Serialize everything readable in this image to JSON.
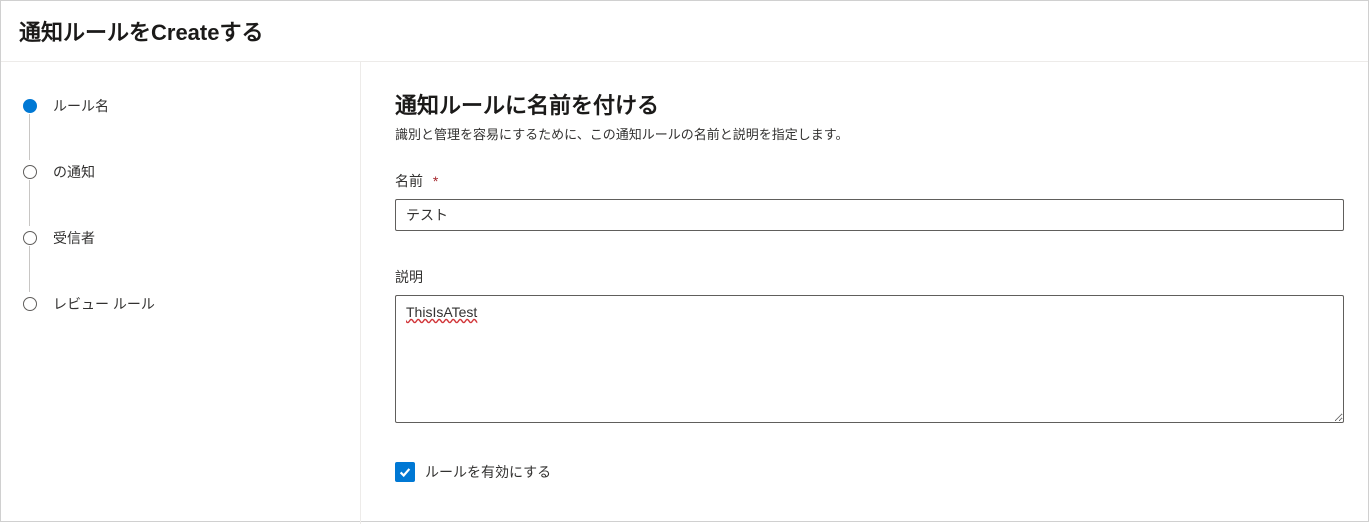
{
  "header": {
    "title": "通知ルールをCreateする"
  },
  "sidebar": {
    "steps": [
      {
        "label": "ルール名",
        "active": true
      },
      {
        "label": "の通知",
        "active": false
      },
      {
        "label": "受信者",
        "active": false
      },
      {
        "label": "レビュー ルール",
        "active": false
      }
    ]
  },
  "main": {
    "section_title": "通知ルールに名前を付ける",
    "section_desc": "識別と管理を容易にするために、この通知ルールの名前と説明を指定します。",
    "name_label": "名前",
    "name_value": "テスト",
    "desc_label": "説明",
    "desc_value": "ThisIsATest",
    "enable_label": "ルールを有効にする",
    "enable_checked": true,
    "required_marker": "*"
  }
}
